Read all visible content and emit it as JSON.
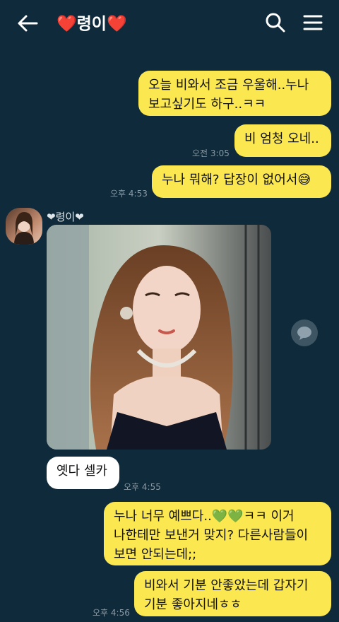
{
  "header": {
    "title_left_heart": "❤️",
    "title_name": "령이",
    "title_right_heart": "❤️",
    "back_icon": "arrow-left-icon",
    "search_icon": "search-icon",
    "menu_icon": "hamburger-menu-icon"
  },
  "messages": {
    "m1": "오늘 비와서 조금 우울해..누나\n보고싶기도 하구..ㅋㅋ",
    "m2": "비 엄청 오네..",
    "t2": "오전 3:05",
    "m3": "누나 뭐해? 답장이 없어서😅",
    "t3": "오후 4:53",
    "sender": "❤령이❤",
    "m4": "옛다 셀카",
    "t4": "오후 4:55",
    "m5": "누나 너무 예쁘다..💚💚ㅋㅋ 이거\n나한테만 보낸거 맞지? 다른사람들이\n보면 안되는데;;",
    "m6": "비와서 기분 안좋았는데 갑자기\n기분 좋아지네ㅎㅎ",
    "t6": "오후 4:56"
  },
  "colors": {
    "background": "#0f2a3a",
    "outgoing_bubble": "#fbe74f",
    "incoming_bubble": "#ffffff",
    "heart": "#e0323f"
  }
}
